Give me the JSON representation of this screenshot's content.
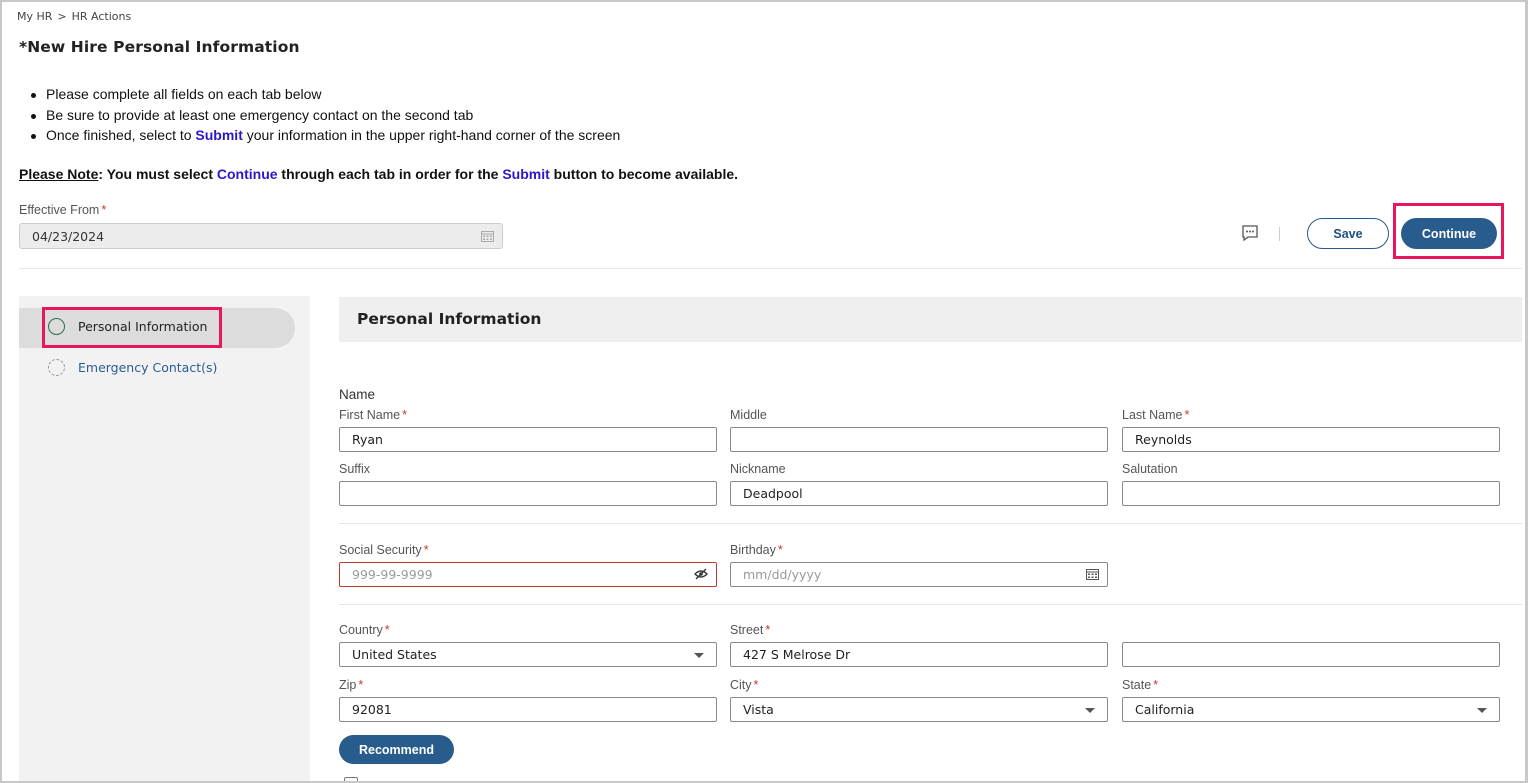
{
  "breadcrumb": {
    "items": [
      "My HR",
      "HR Actions"
    ],
    "separator": ">"
  },
  "page_title": "*New Hire Personal Information",
  "instructions": {
    "line1": "Please complete all fields on each tab below",
    "line2": "Be sure to provide at least one emergency contact on the second tab",
    "line3_prefix": "Once finished, select to ",
    "line3_link": "Submit",
    "line3_suffix": " your information in the upper right-hand corner of the screen"
  },
  "note": {
    "label": "Please Note",
    "part1": ": You must select ",
    "continue_word": "Continue",
    "part2": " through each tab in order for the ",
    "submit_word": "Submit",
    "part3": " button to become available."
  },
  "effective_from": {
    "label": "Effective From",
    "required": "*",
    "value": "04/23/2024"
  },
  "toolbar": {
    "save_label": "Save",
    "continue_label": "Continue"
  },
  "sidebar": {
    "items": [
      {
        "label": "Personal Information",
        "state": "active"
      },
      {
        "label": "Emergency Contact(s)",
        "state": "pending"
      }
    ]
  },
  "section": {
    "title": "Personal Information",
    "name_group_label": "Name",
    "fields": {
      "first_name": {
        "label": "First Name",
        "required": "*",
        "value": "Ryan"
      },
      "middle": {
        "label": "Middle",
        "value": ""
      },
      "last_name": {
        "label": "Last Name",
        "required": "*",
        "value": "Reynolds"
      },
      "suffix": {
        "label": "Suffix",
        "value": ""
      },
      "nickname": {
        "label": "Nickname",
        "value": "Deadpool"
      },
      "salutation": {
        "label": "Salutation",
        "value": ""
      },
      "ssn": {
        "label": "Social Security",
        "required": "*",
        "placeholder": "999-99-9999"
      },
      "birthday": {
        "label": "Birthday",
        "required": "*",
        "placeholder": "mm/dd/yyyy"
      },
      "country": {
        "label": "Country",
        "required": "*",
        "value": "United States"
      },
      "street": {
        "label": "Street",
        "required": "*",
        "value": "427 S Melrose Dr"
      },
      "street2": {
        "value": ""
      },
      "zip": {
        "label": "Zip",
        "required": "*",
        "value": "92081"
      },
      "city": {
        "label": "City",
        "required": "*",
        "value": "Vista"
      },
      "state": {
        "label": "State",
        "required": "*",
        "value": "California"
      }
    },
    "recommend_label": "Recommend"
  },
  "colors": {
    "primary": "#285c8c",
    "highlight": "#e8175d",
    "link": "#2c17c8",
    "required": "#c0392b"
  }
}
